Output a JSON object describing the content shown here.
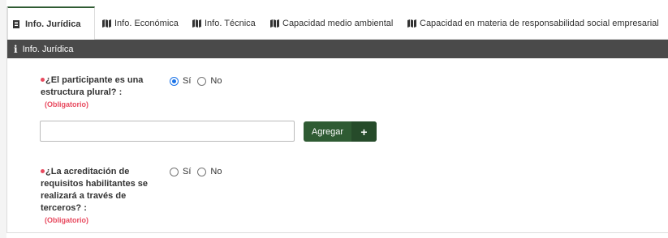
{
  "tabs": [
    {
      "label": "Info. Jurídica",
      "icon": "document-icon",
      "active": true
    },
    {
      "label": "Info. Económica",
      "icon": "map-icon",
      "active": false
    },
    {
      "label": "Info. Técnica",
      "icon": "map-icon",
      "active": false
    },
    {
      "label": "Capacidad medio ambiental",
      "icon": "map-icon",
      "active": false
    },
    {
      "label": "Capacidad en materia de responsabilidad social empresarial",
      "icon": "map-icon",
      "active": false
    }
  ],
  "panel": {
    "icon": "info-icon",
    "icon_glyph": "i",
    "title": "Info. Jurídica"
  },
  "questions": [
    {
      "label_lines": [
        "¿El participante es una",
        "estructura plural? :"
      ],
      "required_text": "(Obligatorio)",
      "options": [
        {
          "label": "Sí",
          "checked": true
        },
        {
          "label": "No",
          "checked": false
        }
      ]
    },
    {
      "label_lines": [
        "¿La acreditación de",
        "requisitos habilitantes se",
        "realizará a través de",
        "terceros? :"
      ],
      "required_text": "(Obligatorio)",
      "options": [
        {
          "label": "Sí",
          "checked": false
        },
        {
          "label": "No",
          "checked": false
        }
      ]
    }
  ],
  "participant_input": {
    "value": "",
    "placeholder": ""
  },
  "add_button": {
    "label": "Agregar",
    "plus": "+"
  },
  "colors": {
    "accent": "#2f5b33",
    "header_bg": "#4a4a4a",
    "required": "#e84a5f",
    "radio_checked": "#1a73e8"
  }
}
